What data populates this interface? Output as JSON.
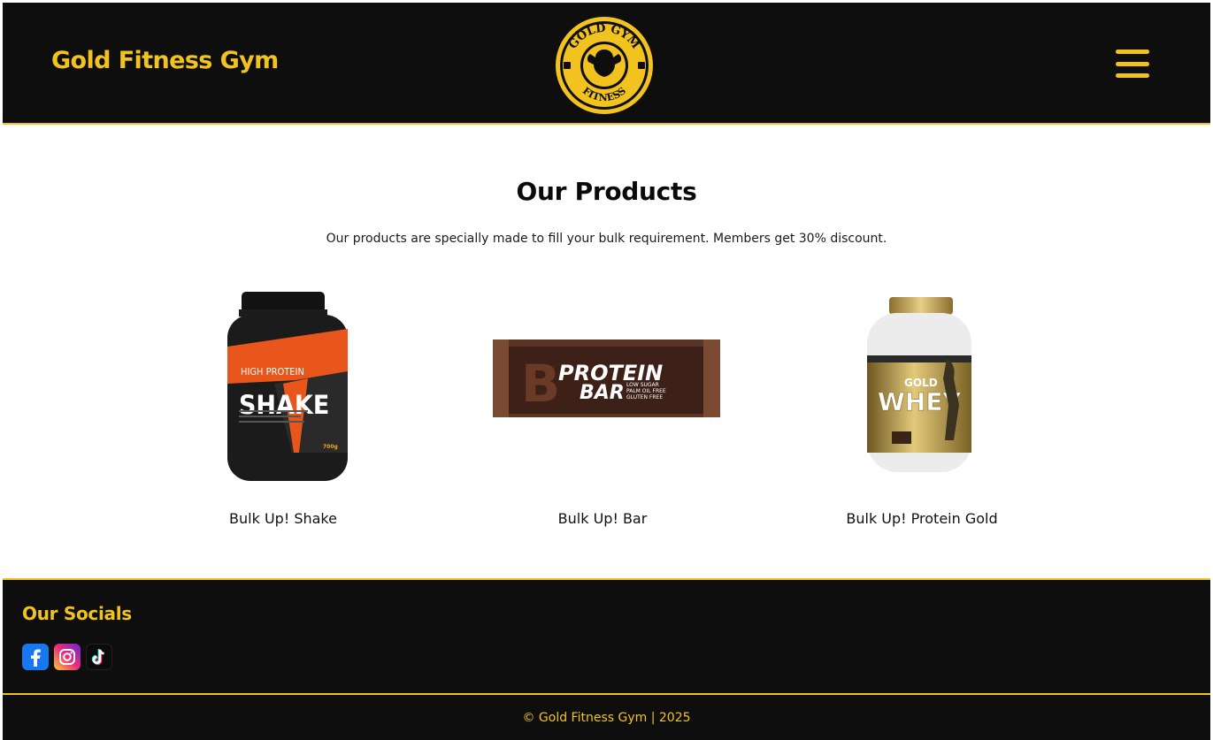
{
  "header": {
    "brand": "Gold Fitness Gym",
    "logo_top_text": "GOLD GYM",
    "logo_bottom_text": "FITNESS",
    "menu_icon": "hamburger-menu-icon"
  },
  "main": {
    "title": "Our Products",
    "subtitle": "Our products are specially made to fill your bulk requirement. Members get 30% discount.",
    "products": [
      {
        "name": "Bulk Up! Shake",
        "image": "protein-shake-tub-image",
        "image_texts": [
          "HIGH PROTEIN",
          "SHAKE",
          "700g"
        ]
      },
      {
        "name": "Bulk Up! Bar",
        "image": "protein-bar-image",
        "image_texts": [
          "PROTEIN",
          "BAR",
          "LOW SUGAR",
          "PALM OIL FREE",
          "GLUTEN FREE"
        ]
      },
      {
        "name": "Bulk Up! Protein Gold",
        "image": "gold-whey-tub-image",
        "image_texts": [
          "GOLD",
          "WHEY"
        ]
      }
    ]
  },
  "footer": {
    "socials_title": "Our Socials",
    "socials": [
      {
        "name": "facebook",
        "icon": "facebook-icon"
      },
      {
        "name": "instagram",
        "icon": "instagram-icon"
      },
      {
        "name": "tiktok",
        "icon": "tiktok-icon"
      }
    ],
    "copyright": "© Gold Fitness Gym | 2025"
  },
  "colors": {
    "accent": "#f2c31f",
    "header_bg": "#0e0e0e",
    "page_bg": "#ffffff"
  }
}
